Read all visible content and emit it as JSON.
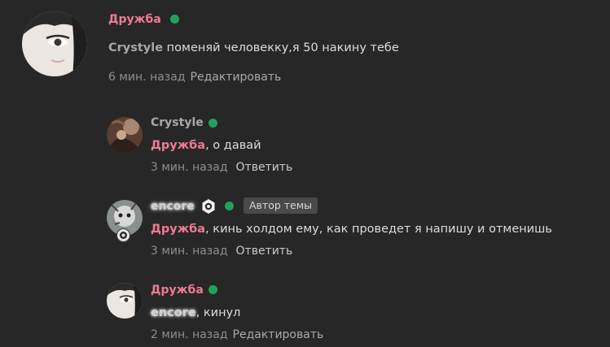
{
  "comments": [
    {
      "author": "Дружба",
      "mention": "Crystyle",
      "text": " поменяй человекку,я 50 накину тебе",
      "time": "6 мин. назад",
      "action": "Редактировать"
    },
    {
      "author": "Crystyle",
      "mention": "Дружба",
      "text": ", о давай",
      "time": "3 мин. назад",
      "action": "Ответить"
    },
    {
      "author": "encore",
      "badge": "Автор темы",
      "mention": "Дружба",
      "text": ", кинь холдом ему, как проведет я напишу и отменишь",
      "time": "3 мин. назад",
      "action": "Ответить"
    },
    {
      "author": "Дружба",
      "mention": "encore",
      "text": ", кинул",
      "time": "2 мин. назад",
      "action": "Редактировать"
    }
  ],
  "colors": {
    "background": "#272727",
    "accent_pink": "#ef7a94",
    "online_green": "#1fa25e",
    "muted": "#8e8e8e"
  },
  "icons": {
    "online": "online-status-icon",
    "verified": "shield-icon",
    "avatar_badge": "eye-badge-icon"
  }
}
